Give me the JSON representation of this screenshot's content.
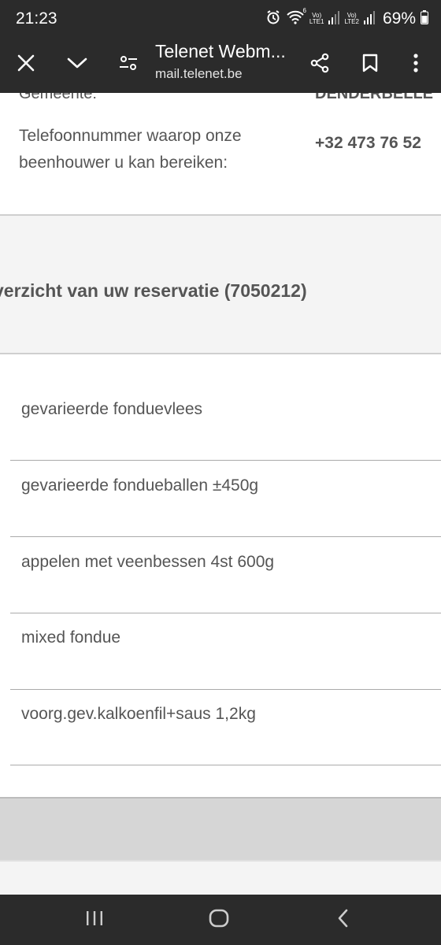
{
  "status_bar": {
    "time": "21:23",
    "network1": "LTE1",
    "network2": "LTE2",
    "volte_tag": "Vo)",
    "wifi_tag": "6",
    "battery": "69%"
  },
  "toolbar": {
    "title": "Telenet Webm...",
    "url": "mail.telenet.be"
  },
  "content": {
    "cut_row_label": "Gemeente:",
    "cut_row_value": "DENDERBELLE",
    "phone_label": "Telefoonnummer waarop onze beenhouwer u kan bereiken:",
    "phone_value": "+32 473 76 52",
    "overview_title": "verzicht van uw reservatie (7050212)",
    "items": [
      "gevarieerde fonduevlees",
      "gevarieerde fondueballen ±450g",
      "appelen met veenbessen 4st 600g",
      "mixed fondue",
      "voorg.gev.kalkoenfil+saus 1,2kg"
    ]
  },
  "icons": {
    "close": "close-icon",
    "chevron": "chevron-down-icon",
    "settings": "tune-icon",
    "share": "share-icon",
    "bookmark": "bookmark-icon",
    "more": "more-vert-icon"
  },
  "colors": {
    "bar_bg": "#2b2b2b",
    "section_bg": "#f4f4f4",
    "footer_gray": "#d6d6d6",
    "text": "#555555"
  }
}
